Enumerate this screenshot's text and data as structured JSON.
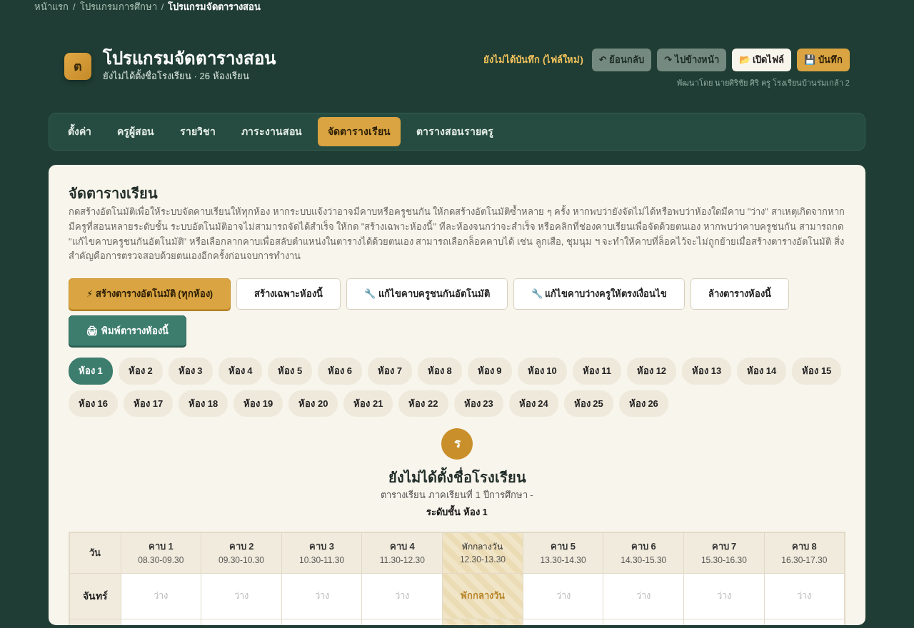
{
  "breadcrumb_separator": "/",
  "breadcrumb": [
    {
      "label": "หน้าแรก",
      "selected": false
    },
    {
      "label": "โปรแกรมการศึกษา",
      "selected": false
    },
    {
      "label": "โปรแกรมจัดตารางสอน",
      "selected": true
    }
  ],
  "header": {
    "logo_letter": "ต",
    "title": "โปรแกรมจัดตารางสอน",
    "subtitle": "ยังไม่ได้ตั้งชื่อโรงเรียน · 26 ห้องเรียน",
    "save_status": "ยังไม่ได้บันทึก (ไฟล์ใหม่)",
    "credit": "พัฒนาโดย นายศิริชัย ศิริ ครู โรงเรียนบ้านร่มเกล้า 2",
    "buttons": [
      {
        "kind": "muted",
        "icon": "↶",
        "label": "ย้อนกลับ"
      },
      {
        "kind": "muted",
        "icon": "↷",
        "label": "ไปข้างหน้า"
      },
      {
        "kind": "light",
        "icon": "📂",
        "label": "เปิดไฟล์"
      },
      {
        "kind": "gold",
        "icon": "💾",
        "label": "บันทึก"
      }
    ]
  },
  "tabs": [
    {
      "label": "ตั้งค่า",
      "selected": false
    },
    {
      "label": "ครูผู้สอน",
      "selected": false
    },
    {
      "label": "รายวิชา",
      "selected": false
    },
    {
      "label": "ภาระงานสอน",
      "selected": false
    },
    {
      "label": "จัดตารางเรียน",
      "selected": true
    },
    {
      "label": "ตารางสอนรายครู",
      "selected": false
    }
  ],
  "panel": {
    "title": "จัดตารางเรียน",
    "description": "กดสร้างอัตโนมัติเพื่อให้ระบบจัดคาบเรียนให้ทุกห้อง หากระบบแจ้งว่าอาจมีคาบหรือครูชนกัน ให้กดสร้างอัตโนมัติซ้ำหลาย ๆ ครั้ง หากพบว่ายังจัดไม่ได้หรือพบว่าห้องใดมีคาบ \"ว่าง\" สาเหตุเกิดจากหากมีครูที่สอนหลายระดับชั้น ระบบอัตโนมัติอาจไม่สามารถจัดได้สำเร็จ ให้กด \"สร้างเฉพาะห้องนี้\" ทีละห้องจนกว่าจะสำเร็จ หรือคลิกที่ช่องคาบเรียนเพื่อจัดด้วยตนเอง หากพบว่าคาบครูชนกัน สามารถกด \"แก้ไขคาบครูชนกันอัตโนมัติ\" หรือเลือกลากคาบเพื่อสลับตำแหน่งในตารางได้ด้วยตนเอง สามารถเลือกล็อคคาบได้ เช่น ลูกเสือ, ชุมนุม ฯ จะทำให้คาบที่ล็อคไว้จะไม่ถูกย้ายเมื่อสร้างตารางอัตโนมัติ สิ่งสำคัญคือการตรวจสอบด้วยตนเองอีกครั้งก่อนจบการทำงาน",
    "actions": [
      {
        "kind": "gold",
        "icon": "⚡",
        "label": "สร้างตารางอัตโนมัติ (ทุกห้อง)"
      },
      {
        "kind": "outline",
        "label": "สร้างเฉพาะห้องนี้"
      },
      {
        "kind": "outline",
        "icon": "🔧",
        "label": "แก้ไขคาบครูชนกันอัตโนมัติ"
      },
      {
        "kind": "outline",
        "icon": "🔧",
        "label": "แก้ไขคาบว่างครูให้ตรงเงื่อนไข"
      },
      {
        "kind": "outline",
        "label": "ล้างตารางห้องนี้"
      },
      {
        "kind": "teal",
        "icon": "🖨",
        "label": "พิมพ์ตารางห้องนี้"
      }
    ],
    "rooms": [
      {
        "label": "ห้อง 1",
        "selected": true
      },
      {
        "label": "ห้อง 2",
        "selected": false
      },
      {
        "label": "ห้อง 3",
        "selected": false
      },
      {
        "label": "ห้อง 4",
        "selected": false
      },
      {
        "label": "ห้อง 5",
        "selected": false
      },
      {
        "label": "ห้อง 6",
        "selected": false
      },
      {
        "label": "ห้อง 7",
        "selected": false
      },
      {
        "label": "ห้อง 8",
        "selected": false
      },
      {
        "label": "ห้อง 9",
        "selected": false
      },
      {
        "label": "ห้อง 10",
        "selected": false
      },
      {
        "label": "ห้อง 11",
        "selected": false
      },
      {
        "label": "ห้อง 12",
        "selected": false
      },
      {
        "label": "ห้อง 13",
        "selected": false
      },
      {
        "label": "ห้อง 14",
        "selected": false
      },
      {
        "label": "ห้อง 15",
        "selected": false
      },
      {
        "label": "ห้อง 16",
        "selected": false
      },
      {
        "label": "ห้อง 17",
        "selected": false
      },
      {
        "label": "ห้อง 18",
        "selected": false
      },
      {
        "label": "ห้อง 19",
        "selected": false
      },
      {
        "label": "ห้อง 20",
        "selected": false
      },
      {
        "label": "ห้อง 21",
        "selected": false
      },
      {
        "label": "ห้อง 22",
        "selected": false
      },
      {
        "label": "ห้อง 23",
        "selected": false
      },
      {
        "label": "ห้อง 24",
        "selected": false
      },
      {
        "label": "ห้อง 25",
        "selected": false
      },
      {
        "label": "ห้อง 26",
        "selected": false
      }
    ],
    "schedule": {
      "badge": "ร",
      "school": "ยังไม่ได้ตั้งชื่อโรงเรียน",
      "term": "ตารางเรียน ภาคเรียนที่ 1 ปีการศึกษา -",
      "level": "ระดับชั้น ห้อง 1",
      "day_header": "วัน",
      "columns": [
        {
          "kind": "period",
          "name": "คาบ 1",
          "time": "08.30-09.30"
        },
        {
          "kind": "period",
          "name": "คาบ 2",
          "time": "09.30-10.30"
        },
        {
          "kind": "period",
          "name": "คาบ 3",
          "time": "10.30-11.30"
        },
        {
          "kind": "period",
          "name": "คาบ 4",
          "time": "11.30-12.30"
        },
        {
          "kind": "break",
          "name": "พักกลางวัน",
          "time": "12.30-13.30"
        },
        {
          "kind": "period",
          "name": "คาบ 5",
          "time": "13.30-14.30"
        },
        {
          "kind": "period",
          "name": "คาบ 6",
          "time": "14.30-15.30"
        },
        {
          "kind": "period",
          "name": "คาบ 7",
          "time": "15.30-16.30"
        },
        {
          "kind": "period",
          "name": "คาบ 8",
          "time": "16.30-17.30"
        }
      ],
      "rows": [
        {
          "day": "จันทร์",
          "cells": [
            "ว่าง",
            "ว่าง",
            "ว่าง",
            "ว่าง",
            "พักกลางวัน",
            "ว่าง",
            "ว่าง",
            "ว่าง",
            "ว่าง"
          ]
        }
      ]
    }
  }
}
